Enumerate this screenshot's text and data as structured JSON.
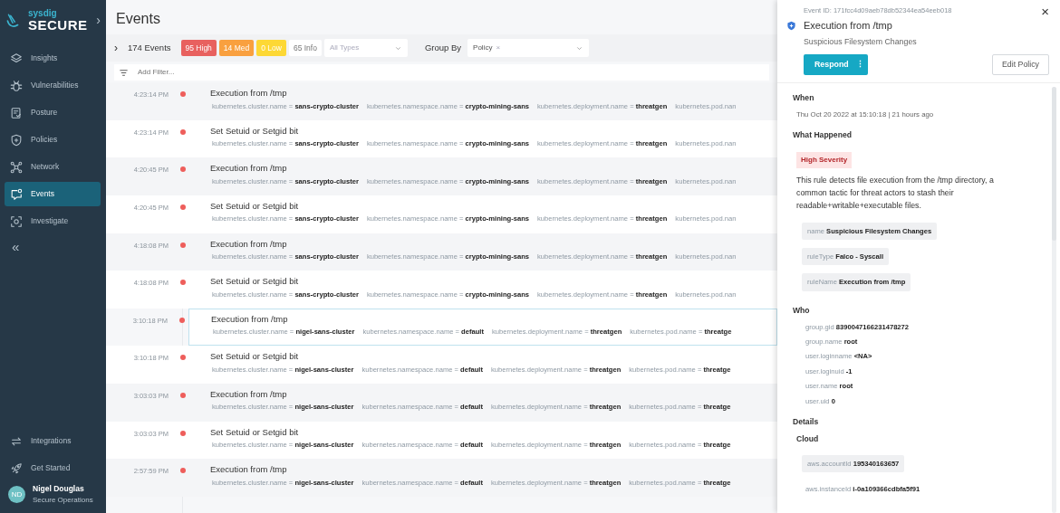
{
  "sidebar": {
    "brand": {
      "name": "sysdig",
      "product": "SECURE",
      "expand": "›"
    },
    "items": [
      {
        "label": "Insights",
        "selected": false
      },
      {
        "label": "Vulnerabilities",
        "selected": false
      },
      {
        "label": "Posture",
        "selected": false
      },
      {
        "label": "Policies",
        "selected": false
      },
      {
        "label": "Network",
        "selected": false
      },
      {
        "label": "Events",
        "selected": true
      },
      {
        "label": "Investigate",
        "selected": false
      }
    ],
    "collapse": "«",
    "bottom_items": [
      {
        "label": "Integrations"
      },
      {
        "label": "Get Started"
      }
    ],
    "user": {
      "initials": "ND",
      "name": "Nigel Douglas",
      "role": "Secure Operations"
    }
  },
  "page_title": "Events",
  "toolbar": {
    "expand": "›",
    "count": "174 Events",
    "severity_filters": [
      {
        "kind": "high",
        "label": "95 High"
      },
      {
        "kind": "med",
        "label": "14 Med"
      },
      {
        "kind": "low",
        "label": "0 Low"
      },
      {
        "kind": "info",
        "label": "65 Info"
      }
    ],
    "type_select": {
      "placeholder": "All Types"
    },
    "group_by": {
      "label": "Group By",
      "chip": "Policy",
      "chip_remove": "×"
    }
  },
  "filter": {
    "placeholder": "Add Filter..."
  },
  "events": [
    {
      "time": "4:23:14 PM",
      "title": "Execution from /tmp",
      "selected": false,
      "tags": [
        "kubernetes.cluster.name = **sans-crypto-cluster**",
        "kubernetes.namespace.name = **crypto-mining-sans**",
        "kubernetes.deployment.name = **threatgen**",
        "kubernetes.pod.nan"
      ]
    },
    {
      "time": "4:23:14 PM",
      "title": "Set Setuid or Setgid bit",
      "selected": false,
      "tags": [
        "kubernetes.cluster.name = **sans-crypto-cluster**",
        "kubernetes.namespace.name = **crypto-mining-sans**",
        "kubernetes.deployment.name = **threatgen**",
        "kubernetes.pod.nan"
      ]
    },
    {
      "time": "4:20:45 PM",
      "title": "Execution from /tmp",
      "selected": false,
      "tags": [
        "kubernetes.cluster.name = **sans-crypto-cluster**",
        "kubernetes.namespace.name = **crypto-mining-sans**",
        "kubernetes.deployment.name = **threatgen**",
        "kubernetes.pod.nan"
      ]
    },
    {
      "time": "4:20:45 PM",
      "title": "Set Setuid or Setgid bit",
      "selected": false,
      "tags": [
        "kubernetes.cluster.name = **sans-crypto-cluster**",
        "kubernetes.namespace.name = **crypto-mining-sans**",
        "kubernetes.deployment.name = **threatgen**",
        "kubernetes.pod.nan"
      ]
    },
    {
      "time": "4:18:08 PM",
      "title": "Execution from /tmp",
      "selected": false,
      "tags": [
        "kubernetes.cluster.name = **sans-crypto-cluster**",
        "kubernetes.namespace.name = **crypto-mining-sans**",
        "kubernetes.deployment.name = **threatgen**",
        "kubernetes.pod.nan"
      ]
    },
    {
      "time": "4:18:08 PM",
      "title": "Set Setuid or Setgid bit",
      "selected": false,
      "tags": [
        "kubernetes.cluster.name = **sans-crypto-cluster**",
        "kubernetes.namespace.name = **crypto-mining-sans**",
        "kubernetes.deployment.name = **threatgen**",
        "kubernetes.pod.nan"
      ]
    },
    {
      "time": "3:10:18 PM",
      "title": "Execution from /tmp",
      "selected": true,
      "tags": [
        "kubernetes.cluster.name = **nigel-sans-cluster**",
        "kubernetes.namespace.name = **default**",
        "kubernetes.deployment.name = **threatgen**",
        "kubernetes.pod.name = **threatge**"
      ]
    },
    {
      "time": "3:10:18 PM",
      "title": "Set Setuid or Setgid bit",
      "selected": false,
      "tags": [
        "kubernetes.cluster.name = **nigel-sans-cluster**",
        "kubernetes.namespace.name = **default**",
        "kubernetes.deployment.name = **threatgen**",
        "kubernetes.pod.name = **threatge**"
      ]
    },
    {
      "time": "3:03:03 PM",
      "title": "Execution from /tmp",
      "selected": false,
      "tags": [
        "kubernetes.cluster.name = **nigel-sans-cluster**",
        "kubernetes.namespace.name = **default**",
        "kubernetes.deployment.name = **threatgen**",
        "kubernetes.pod.name = **threatge**"
      ]
    },
    {
      "time": "3:03:03 PM",
      "title": "Set Setuid or Setgid bit",
      "selected": false,
      "tags": [
        "kubernetes.cluster.name = **nigel-sans-cluster**",
        "kubernetes.namespace.name = **default**",
        "kubernetes.deployment.name = **threatgen**",
        "kubernetes.pod.name = **threatge**"
      ]
    },
    {
      "time": "2:57:59 PM",
      "title": "Execution from /tmp",
      "selected": false,
      "tags": [
        "kubernetes.cluster.name = **nigel-sans-cluster**",
        "kubernetes.namespace.name = **default**",
        "kubernetes.deployment.name = **threatgen**",
        "kubernetes.pod.name = **threatge**"
      ]
    }
  ],
  "detail": {
    "event_id": "Event ID: 171fcc4d09aeb78db52344ea54eeb018",
    "close": "×",
    "title": "Execution from /tmp",
    "subtitle": "Suspicious Filesystem Changes",
    "buttons": [
      {
        "kind": "primary",
        "label": "Respond",
        "menu": "⋮"
      },
      {
        "kind": "outline",
        "label": "Edit Policy"
      }
    ],
    "sections": [
      {
        "heading": "When",
        "kind": "text",
        "text": "Thu Oct 20 2022 at 15:10:18 | 21 hours ago"
      },
      {
        "heading": "What Happened",
        "kind": "what",
        "severity": "High Severity",
        "text": "This rule detects file execution from the /tmp directory, a common tactic for threat actors to stash their readable+writable+executable files.",
        "chips": [
          "name **Suspicious Filesystem Changes**",
          "ruleType **Falco - Syscall**",
          "ruleName **Execution from /tmp**"
        ]
      },
      {
        "heading": "Who",
        "kind": "fields",
        "fields": [
          "group.gid **8390047166231478272**",
          "group.name **root**",
          "user.loginname **<NA>**",
          "user.loginuid **-1**",
          "user.name **root**",
          "user.uid **0**"
        ]
      },
      {
        "heading": "Details",
        "kind": "details",
        "subheading": "Cloud",
        "fields": [
          {
            "text": "aws.accountId **195340163657**",
            "highlighted": true
          },
          {
            "text": "aws.instanceId **i-0a109366cdbfa5f91**",
            "highlighted": false
          }
        ]
      }
    ]
  }
}
